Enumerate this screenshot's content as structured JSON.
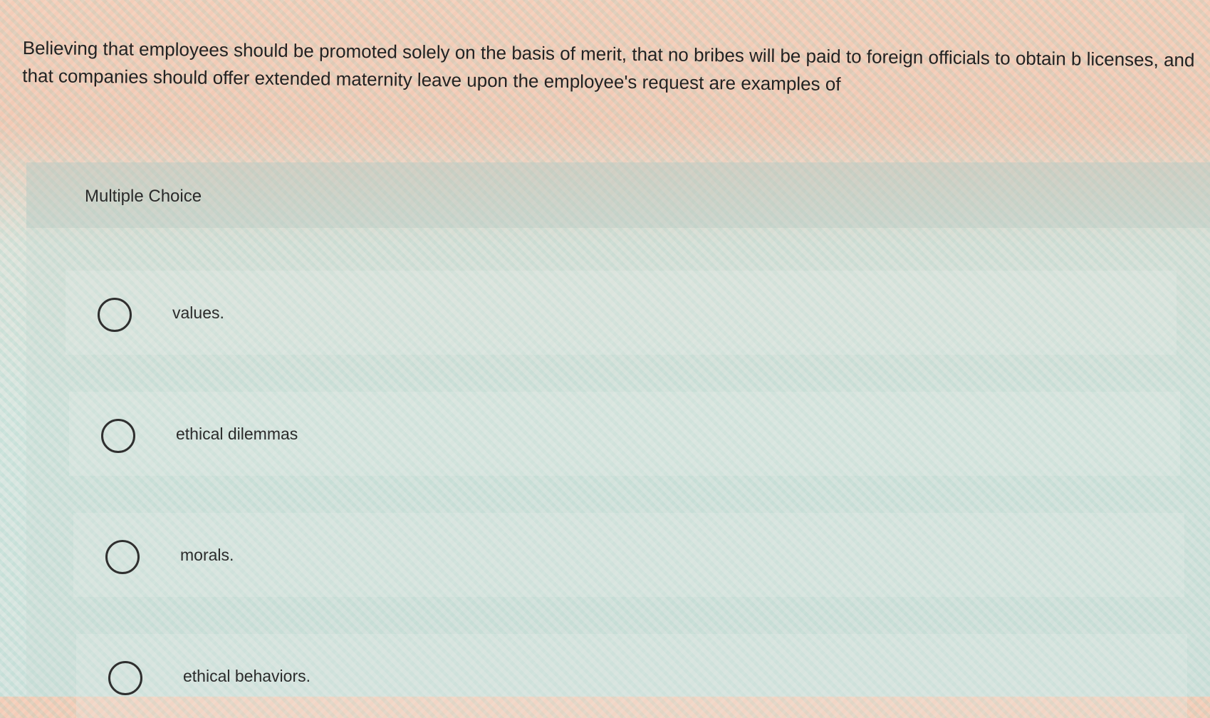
{
  "question": {
    "text": "Believing that employees should be promoted solely on the basis of merit, that no bribes will be paid to foreign officials to obtain b licenses, and that companies should offer extended maternity leave upon the employee's request are examples of"
  },
  "panel": {
    "title": "Multiple Choice"
  },
  "options": [
    {
      "label": "values.",
      "selected": false
    },
    {
      "label": "ethical dilemmas",
      "selected": false
    },
    {
      "label": "morals.",
      "selected": false
    },
    {
      "label": "ethical behaviors.",
      "selected": false
    }
  ],
  "colors": {
    "text": "#222222",
    "radio_border": "#2f2f2f"
  }
}
